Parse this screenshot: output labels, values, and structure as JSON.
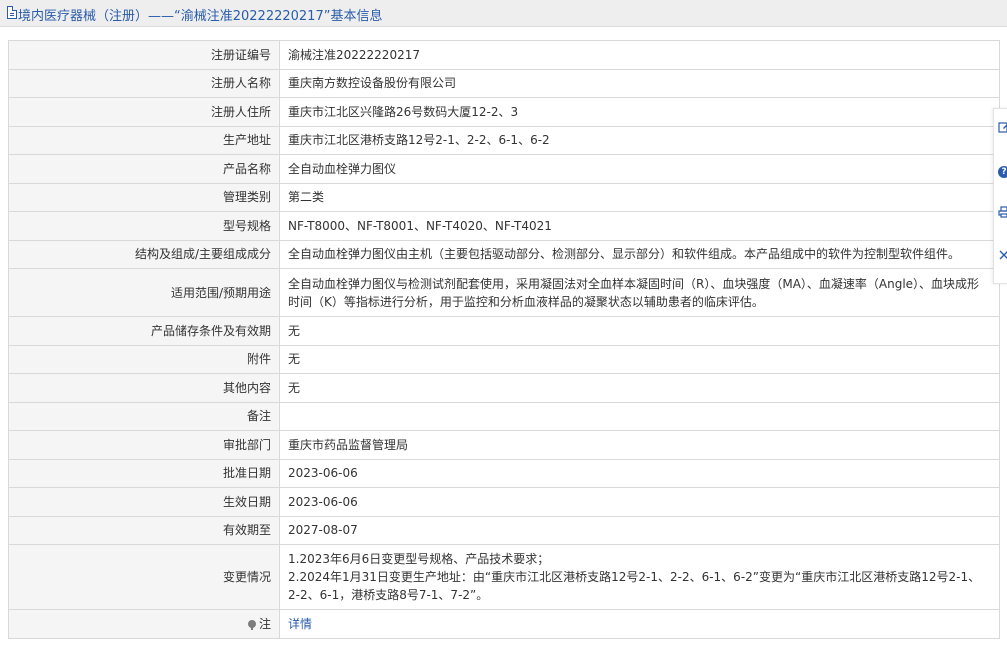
{
  "header": {
    "title": "境内医疗器械（注册）——“渝械注准20222220217”基本信息"
  },
  "rows": [
    {
      "label": "注册证编号",
      "value": "渝械注准20222220217"
    },
    {
      "label": "注册人名称",
      "value": "重庆南方数控设备股份有限公司"
    },
    {
      "label": "注册人住所",
      "value": "重庆市江北区兴隆路26号数码大厦12-2、3"
    },
    {
      "label": "生产地址",
      "value": "重庆市江北区港桥支路12号2-1、2-2、6-1、6-2"
    },
    {
      "label": "产品名称",
      "value": "全自动血栓弹力图仪"
    },
    {
      "label": "管理类别",
      "value": "第二类"
    },
    {
      "label": "型号规格",
      "value": "NF-T8000、NF-T8001、NF-T4020、NF-T4021"
    },
    {
      "label": "结构及组成/主要组成成分",
      "value": "全自动血栓弹力图仪由主机（主要包括驱动部分、检测部分、显示部分）和软件组成。本产品组成中的软件为控制型软件组件。"
    },
    {
      "label": "适用范围/预期用途",
      "value": "全自动血栓弹力图仪与检测试剂配套使用，采用凝固法对全血样本凝固时间（R）、血块强度（MA）、血凝速率（Angle）、血块成形时间（K）等指标进行分析，用于监控和分析血液样品的凝聚状态以辅助患者的临床评估。"
    },
    {
      "label": "产品储存条件及有效期",
      "value": "无"
    },
    {
      "label": "附件",
      "value": "无"
    },
    {
      "label": "其他内容",
      "value": "无"
    },
    {
      "label": "备注",
      "value": ""
    },
    {
      "label": "审批部门",
      "value": "重庆市药品监督管理局"
    },
    {
      "label": "批准日期",
      "value": "2023-06-06"
    },
    {
      "label": "生效日期",
      "value": "2023-06-06"
    },
    {
      "label": "有效期至",
      "value": "2027-08-07"
    }
  ],
  "change": {
    "label": "变更情况",
    "lines": [
      "1.2023年6月6日变更型号规格、产品技术要求；",
      "2.2024年1月31日变更生产地址：由“重庆市江北区港桥支路12号2-1、2-2、6-1、6-2”变更为“重庆市江北区港桥支路12号2-1、2-2、6-1，港桥支路8号7-1、7-2”。"
    ]
  },
  "note": {
    "label": "注",
    "link_text": "详情"
  }
}
